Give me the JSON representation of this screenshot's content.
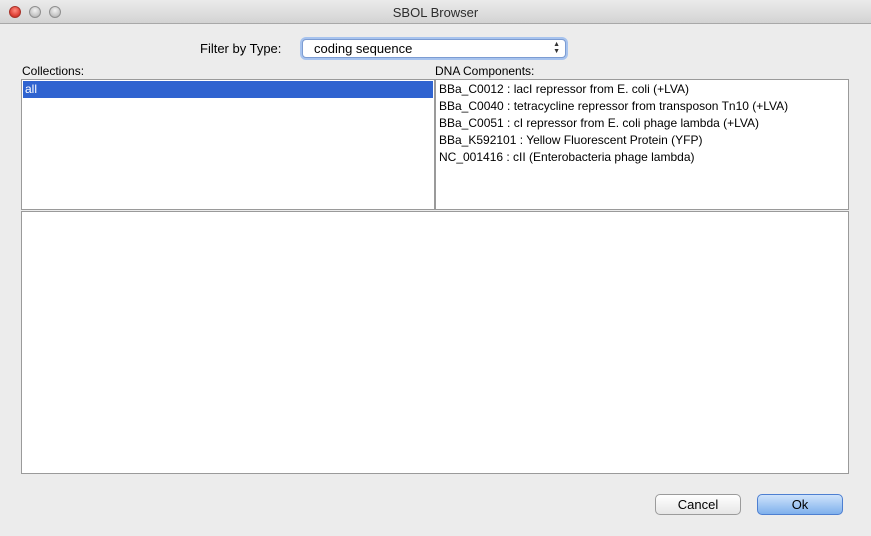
{
  "window": {
    "title": "SBOL Browser"
  },
  "filter": {
    "label": "Filter by Type:",
    "selected": "coding sequence"
  },
  "collections": {
    "label": "Collections:",
    "items": [
      "all"
    ]
  },
  "dna_components": {
    "label": "DNA Components:",
    "items": [
      "BBa_C0012 : lacI repressor from E. coli (+LVA)",
      "BBa_C0040 : tetracycline repressor from transposon Tn10 (+LVA)",
      "BBa_C0051 : cI repressor from E. coli phage lambda (+LVA)",
      "BBa_K592101 : Yellow Fluorescent Protein (YFP)",
      "NC_001416 : cII (Enterobacteria phage lambda)"
    ]
  },
  "buttons": {
    "cancel": "Cancel",
    "ok": "Ok"
  }
}
